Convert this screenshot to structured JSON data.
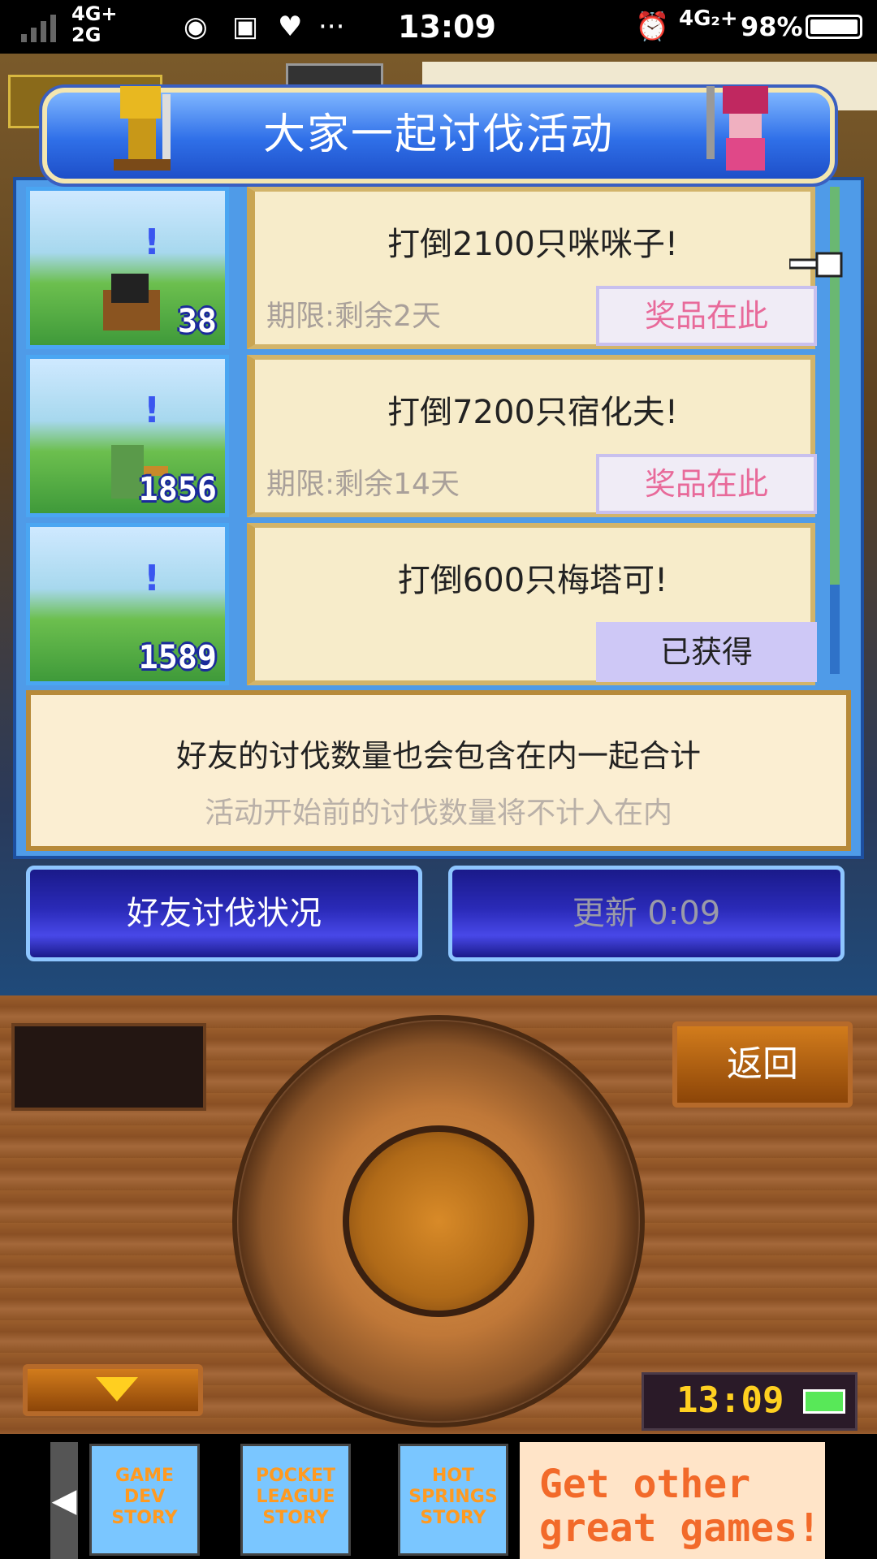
{
  "status_bar": {
    "network_left": "4G+",
    "network_left_2": "2G",
    "time": "13:09",
    "network_right": "4G₂+",
    "battery": "98%",
    "icons": [
      "weibo-icon",
      "app-icon",
      "vpn-icon",
      "more-icon",
      "alarm-icon"
    ]
  },
  "panel": {
    "title": "大家一起讨伐活动",
    "events": [
      {
        "quest": "打倒2100只咪咪子!",
        "deadline": "期限:剩余2天",
        "action": "奖品在此",
        "count": "38",
        "state": "prize"
      },
      {
        "quest": "打倒7200只宿化夫!",
        "deadline": "期限:剩余14天",
        "action": "奖品在此",
        "count": "1856",
        "state": "prize"
      },
      {
        "quest": "打倒600只梅塔可!",
        "deadline": "",
        "action": "已获得",
        "count": "1589",
        "state": "obtained"
      }
    ],
    "note_line1": "好友的讨伐数量也会包含在内一起合计",
    "note_line2": "活动开始前的讨伐数量将不计入在内",
    "friend_status_button": "好友讨伐状况",
    "refresh_button": "更新 0:09"
  },
  "controller": {
    "back_button": "返回",
    "clock": "13:09"
  },
  "ad": {
    "tiles": [
      "GAME DEV STORY",
      "POCKET LEAGUE STORY",
      "HOT SPRINGS STORY"
    ],
    "cta_line1": "Get other",
    "cta_line2": "great games!"
  },
  "colors": {
    "panel_blue": "#4f9be8",
    "prize_text": "#e86a9a",
    "card_bg": "#f7ecca"
  }
}
